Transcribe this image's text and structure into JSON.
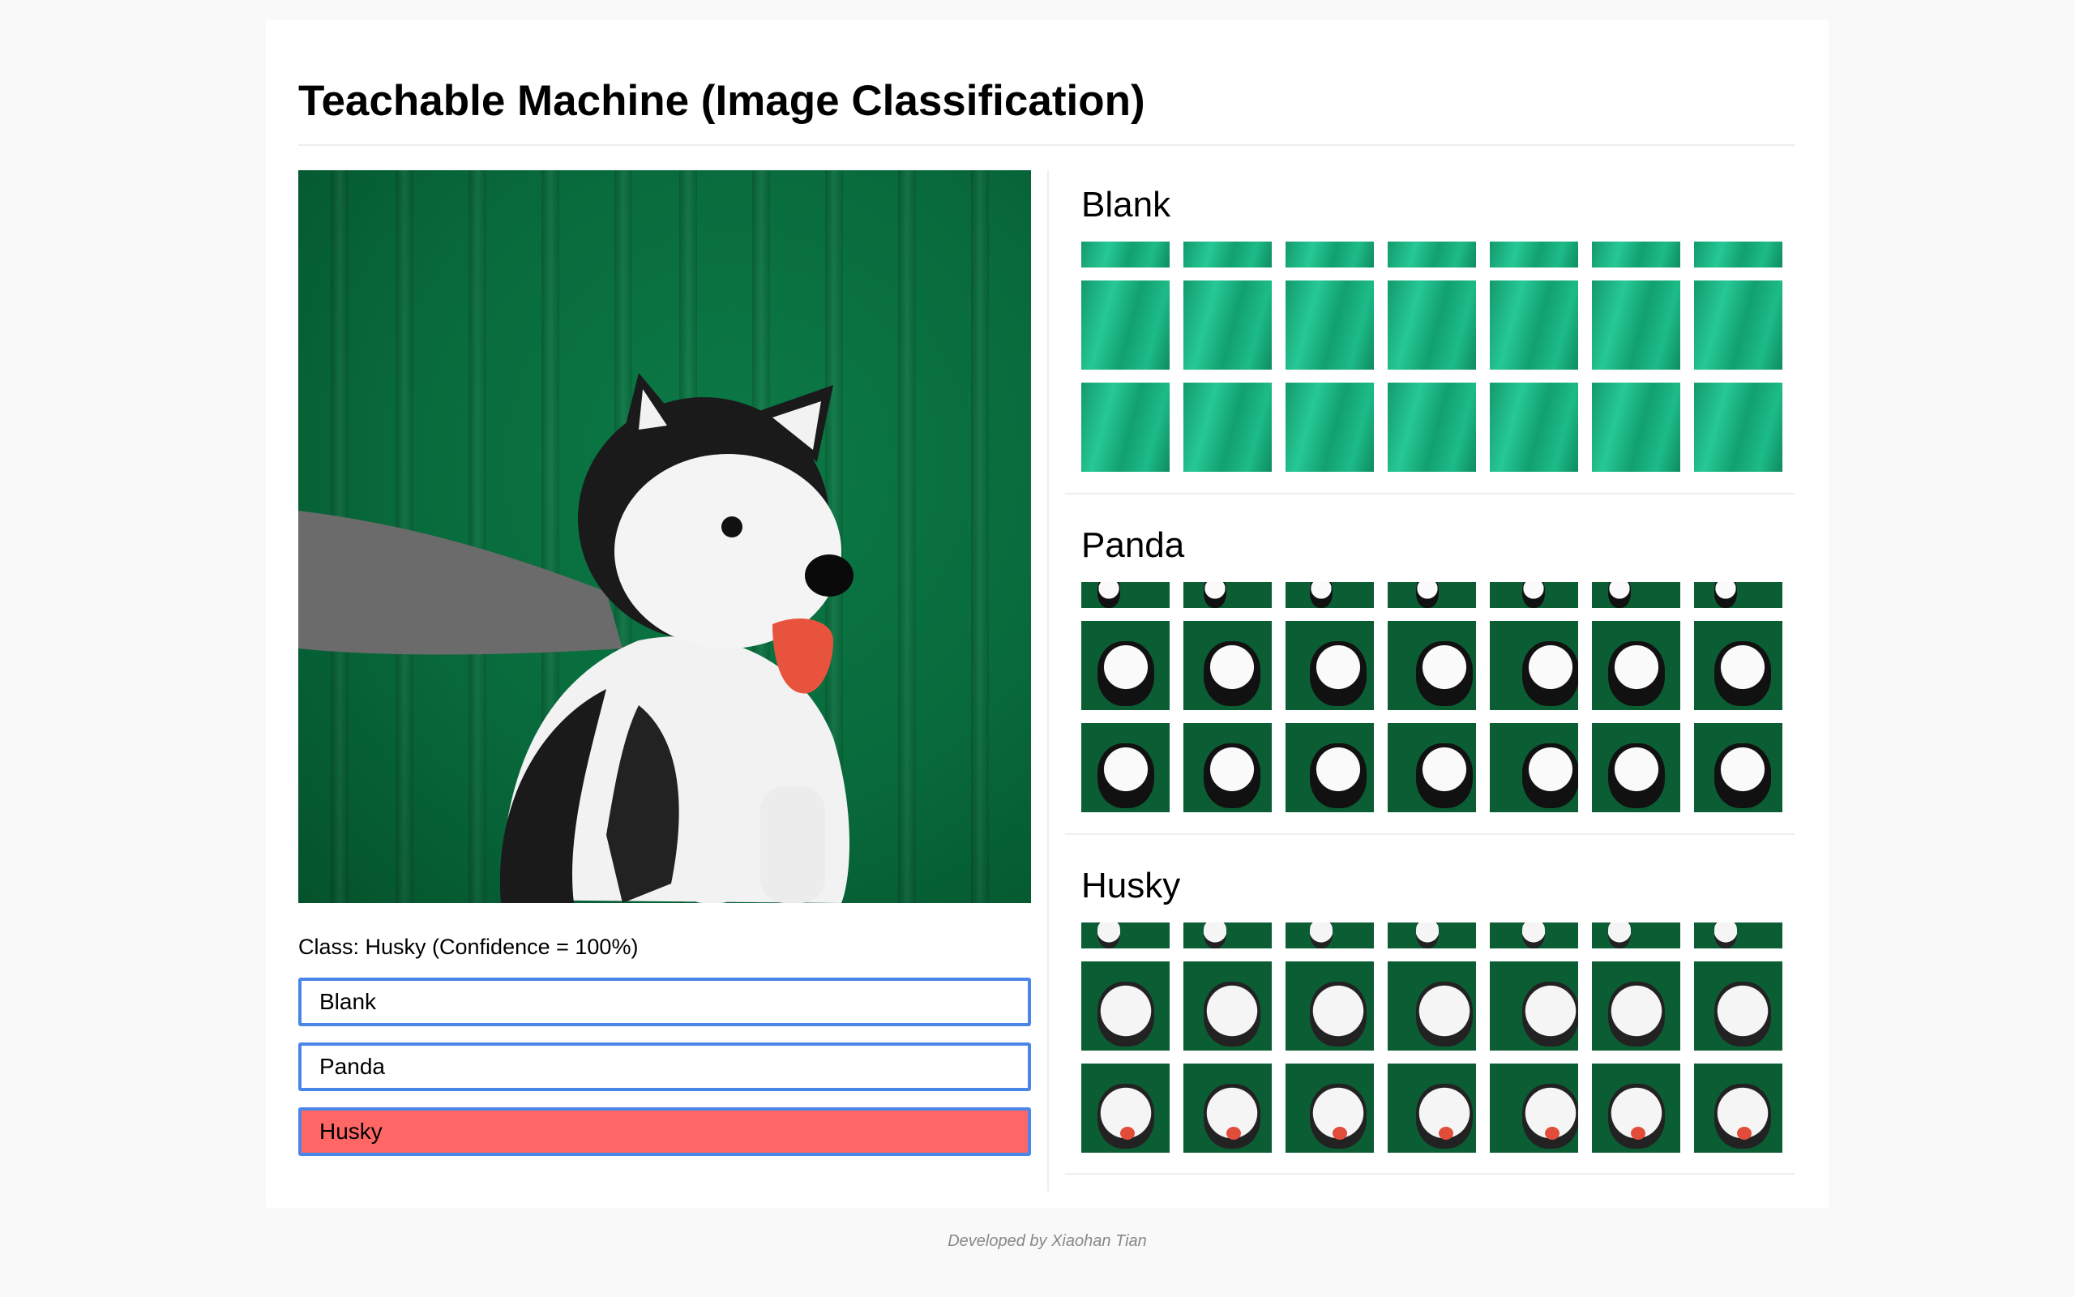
{
  "app": {
    "title": "Teachable Machine (Image Classification)",
    "footer": "Developed by Xiaohan Tian"
  },
  "prediction": {
    "text": "Class: Husky (Confidence = 100%)",
    "classes": [
      "Blank",
      "Panda",
      "Husky"
    ],
    "active": "Husky",
    "active_color": "#ff6767",
    "border_color": "#4a86e8"
  },
  "sections": [
    {
      "title": "Blank"
    },
    {
      "title": "Panda"
    },
    {
      "title": "Husky"
    }
  ]
}
